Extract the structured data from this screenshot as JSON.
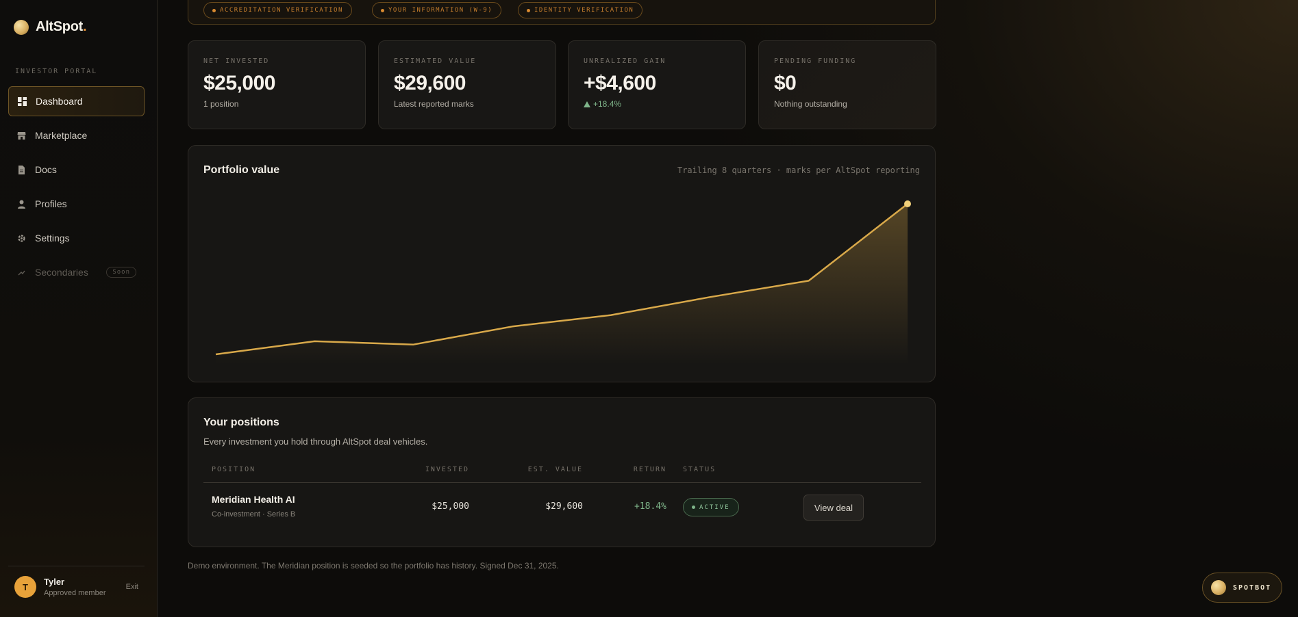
{
  "brand": {
    "name": "AltSpot",
    "dot": "."
  },
  "sidebar": {
    "section_label": "INVESTOR PORTAL",
    "items": [
      {
        "label": "Dashboard",
        "icon": "dashboard-icon",
        "active": true
      },
      {
        "label": "Marketplace",
        "icon": "store-icon"
      },
      {
        "label": "Docs",
        "icon": "document-icon"
      },
      {
        "label": "Profiles",
        "icon": "person-icon"
      },
      {
        "label": "Settings",
        "icon": "gear-icon"
      },
      {
        "label": "Secondaries",
        "icon": "trend-icon",
        "disabled": true,
        "badge": "Soon"
      }
    ],
    "user": {
      "initial": "T",
      "name": "Tyler",
      "role": "Approved member",
      "exit": "Exit"
    }
  },
  "checklist": {
    "pills": [
      "ACCREDITATION VERIFICATION",
      "YOUR INFORMATION (W-9)",
      "IDENTITY VERIFICATION"
    ]
  },
  "stats": [
    {
      "label": "NET INVESTED",
      "value": "$25,000",
      "sub": "1 position"
    },
    {
      "label": "ESTIMATED VALUE",
      "value": "$29,600",
      "sub": "Latest reported marks"
    },
    {
      "label": "UNREALIZED GAIN",
      "value": "+$4,600",
      "sub": "+18.4%"
    },
    {
      "label": "PENDING FUNDING",
      "value": "$0",
      "sub": "Nothing outstanding"
    }
  ],
  "portfolio_chart": {
    "title": "Portfolio value",
    "note": "Trailing 8 quarters · marks per AltSpot reporting"
  },
  "chart_data": {
    "type": "area",
    "title": "Portfolio value",
    "xlabel": "",
    "ylabel": "",
    "x": [
      1,
      2,
      3,
      4,
      5,
      6,
      7,
      8
    ],
    "values": [
      25000,
      25400,
      25300,
      25850,
      26200,
      26750,
      27250,
      29600
    ],
    "ylim": [
      25000,
      29600
    ],
    "grid": false,
    "color": "#d9a94a"
  },
  "positions": {
    "title": "Your positions",
    "subtitle": "Every investment you hold through AltSpot deal vehicles.",
    "headers": {
      "position": "POSITION",
      "invested": "INVESTED",
      "est_value": "EST. VALUE",
      "return": "RETURN",
      "status": "STATUS"
    },
    "rows": [
      {
        "name": "Meridian Health AI",
        "meta": "Co-investment · Series B",
        "invested": "$25,000",
        "est_value": "$29,600",
        "return": "+18.4%",
        "status": "ACTIVE",
        "action": "View deal"
      }
    ]
  },
  "footnote": "Demo environment. The Meridian position is seeded so the portfolio has history. Signed Dec 31, 2025.",
  "spotbot": {
    "label": "SPOTBOT"
  },
  "colors": {
    "accent": "#d9a94a",
    "gain": "#7fb58a",
    "warning": "#c77f2e"
  }
}
